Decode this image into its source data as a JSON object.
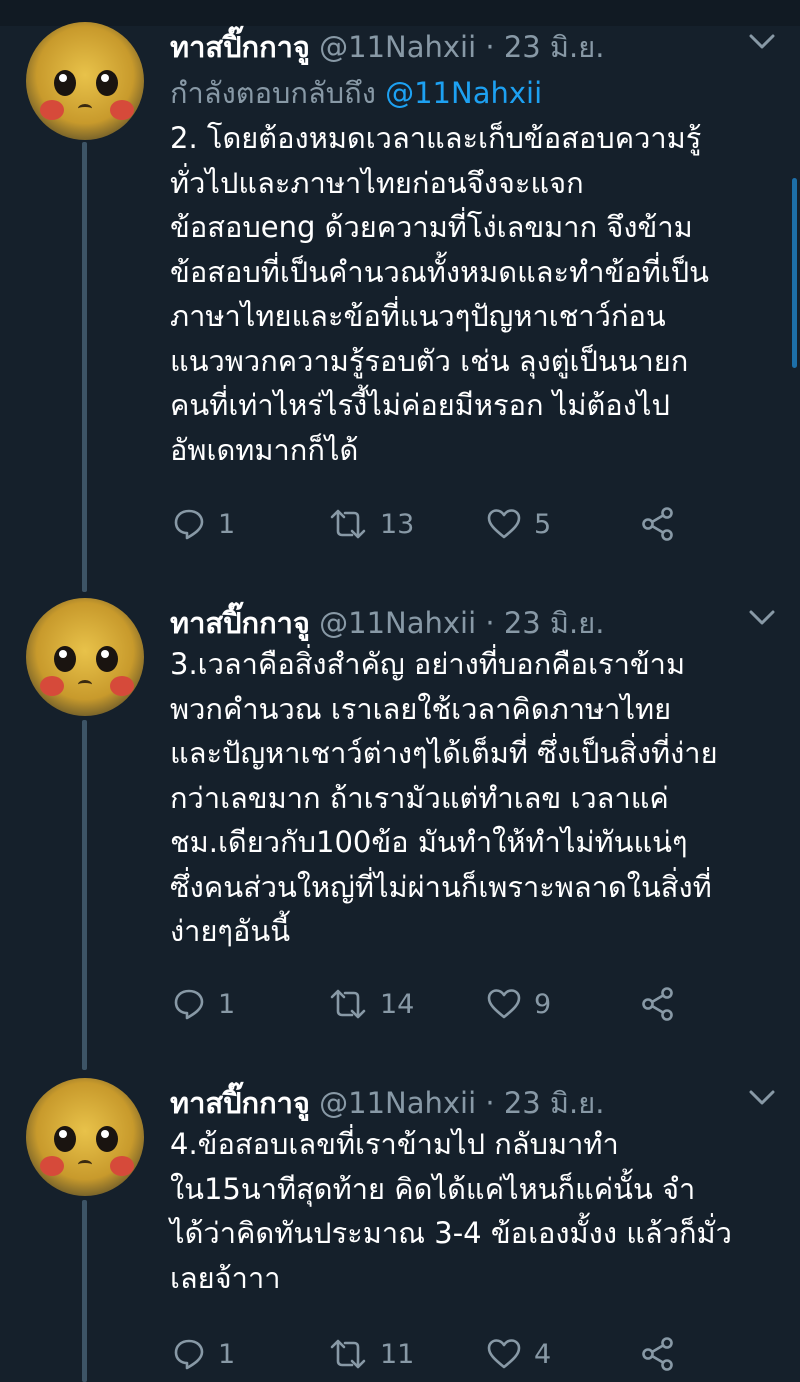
{
  "colors": {
    "background": "#15202b",
    "text": "#ffffff",
    "secondary": "#8899a6",
    "accent": "#1da1f2",
    "thread_line": "#3d5466"
  },
  "tweets": [
    {
      "name": "ทาสปิ๊กกาจู",
      "handle": "@11Nahxii",
      "separator": "·",
      "date": "23 มิ.ย.",
      "reply_label": "กำลังตอบกลับถึง",
      "reply_mention": "@11Nahxii",
      "lines": [
        "2. โดยต้องหมดเวลาและเก็บข้อสอบความรู้",
        "ทั่วไปและภาษาไทยก่อนจึงจะแจก",
        "ข้อสอบeng ด้วยความที่โง่เลขมาก จึงข้าม",
        "ข้อสอบที่เป็นคำนวณทั้งหมดและทำข้อที่เป็น",
        "ภาษาไทยและข้อที่แนวๆปัญหาเชาว์ก่อน",
        "แนวพวกความรู้รอบตัว เช่น ลุงตู่เป็นนายก",
        "คนที่เท่าไหร่ไรงี้ไม่ค่อยมีหรอก ไม่ต้องไป",
        "อัพเดทมากก็ได้"
      ],
      "replies": "1",
      "retweets": "13",
      "likes": "5"
    },
    {
      "name": "ทาสปิ๊กกาจู",
      "handle": "@11Nahxii",
      "separator": "·",
      "date": "23 มิ.ย.",
      "lines": [
        "3.เวลาคือสิ่งสำคัญ อย่างที่บอกคือเราข้าม",
        "พวกคำนวณ เราเลยใช้เวลาคิดภาษาไทย",
        "และปัญหาเชาว์ต่างๆได้เต็มที่ ซึ่งเป็นสิ่งที่ง่าย",
        "กว่าเลขมาก ถ้าเรามัวแต่ทำเลข เวลาแค่",
        "ชม.เดียวกับ100ข้อ มันทำให้ทำไม่ทันแน่ๆ",
        "ซึ่งคนส่วนใหญ่ที่ไม่ผ่านก็เพราะพลาดในสิ่งที่",
        "ง่ายๆอันนี้"
      ],
      "replies": "1",
      "retweets": "14",
      "likes": "9"
    },
    {
      "name": "ทาสปิ๊กกาจู",
      "handle": "@11Nahxii",
      "separator": "·",
      "date": "23 มิ.ย.",
      "lines": [
        "4.ข้อสอบเลขที่เราข้ามไป กลับมาทำ",
        "ใน15นาทีสุดท้าย คิดได้แค่ไหนก็แค่นั้น จำ",
        "ได้ว่าคิดทันประมาณ 3-4 ข้อเองมั้งง แล้วก็มั่ว",
        "เลยจ้าาา"
      ],
      "replies": "1",
      "retweets": "11",
      "likes": "4"
    }
  ]
}
